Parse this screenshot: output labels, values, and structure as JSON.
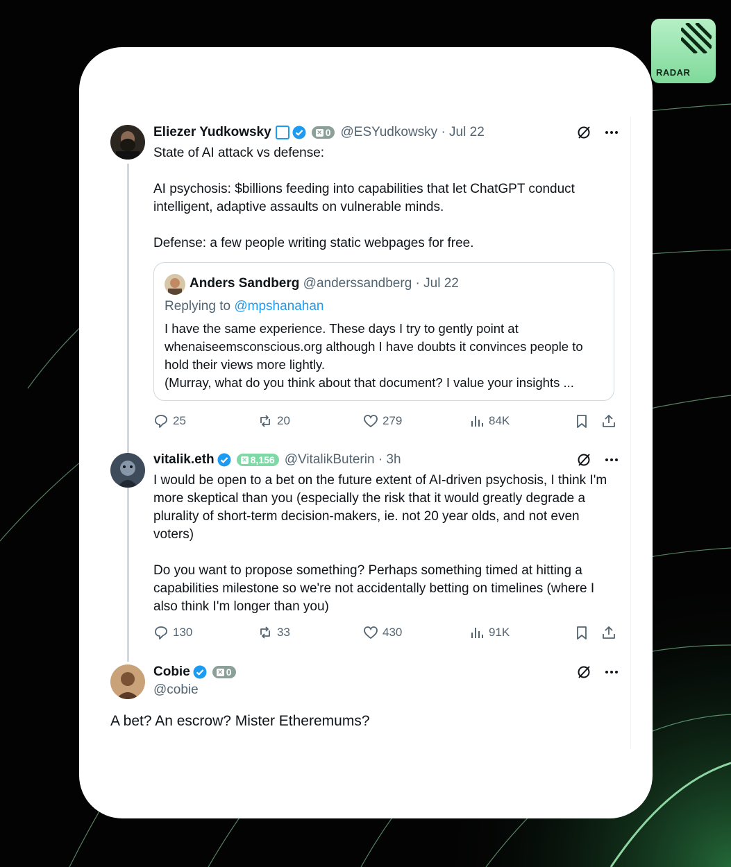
{
  "brand": {
    "logo_text": "RADAR",
    "accent": "#7fd99a"
  },
  "tweets": [
    {
      "name": "Eliezer Yudkowsky",
      "handle": "@ESYudkowsky",
      "time": "· Jul 22",
      "pill": "0",
      "text": "State of AI attack vs defense:\n\nAI psychosis: $billions feeding into capabilities that let ChatGPT conduct intelligent, adaptive assaults on vulnerable minds.\n\nDefense: a few people writing static webpages for free.",
      "quote": {
        "name": "Anders Sandberg",
        "handle": "@anderssandberg · Jul 22",
        "replying_prefix": "Replying to ",
        "replying_to": "@mpshanahan",
        "text": "I have the same experience. These days I try to gently point at whenaiseemsconscious.org although I have doubts it convinces people to hold their views more lightly.\n(Murray, what do you think about that document? I value your insights ..."
      },
      "stats": {
        "replies": "25",
        "reposts": "20",
        "likes": "279",
        "views": "84K"
      }
    },
    {
      "name": "vitalik.eth",
      "handle": "@VitalikButerin",
      "time": "· 3h",
      "pill": "8,156",
      "text": "I would be open to a bet on the future extent of AI-driven psychosis, I think I'm more skeptical than you (especially the risk that it would greatly degrade a plurality of short-term decision-makers, ie. not 20 year olds, and not even voters)\n\nDo you want to propose something? Perhaps something timed at hitting a capabilities milestone so we're not accidentally betting on timelines (where I also think I'm longer than you)",
      "stats": {
        "replies": "130",
        "reposts": "33",
        "likes": "430",
        "views": "91K"
      }
    },
    {
      "name": "Cobie",
      "handle": "@cobie",
      "pill": "0",
      "text": "A bet? An escrow? Mister Etheremums?"
    }
  ]
}
